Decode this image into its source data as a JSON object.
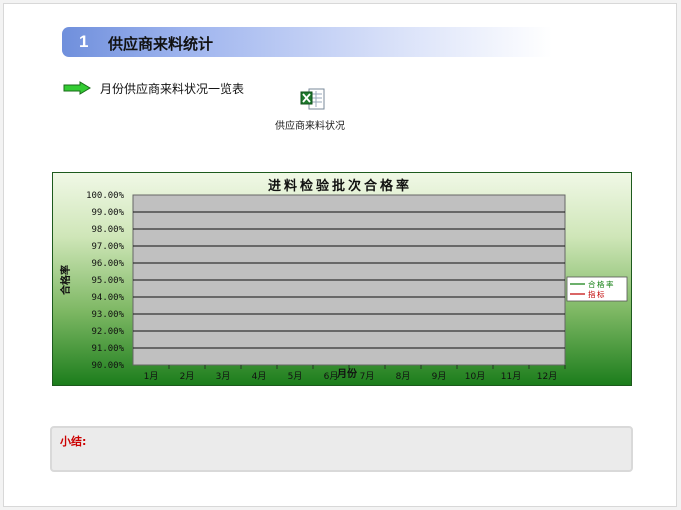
{
  "section": {
    "number": "1",
    "title": "供应商来料统计"
  },
  "subheading": "月份供应商来料状况一览表",
  "attachment": {
    "label": "供应商来料状况",
    "icon": "excel-file-icon"
  },
  "colors": {
    "target_line": "#c00000",
    "pass_line": "#0a7a0a",
    "header_start": "#6f8fdc"
  },
  "chart_data": {
    "type": "line",
    "title": "进料检验批次合格率",
    "xlabel": "月份",
    "ylabel": "合格率",
    "categories": [
      "1月",
      "2月",
      "3月",
      "4月",
      "5月",
      "6月",
      "7月",
      "8月",
      "9月",
      "10月",
      "11月",
      "12月"
    ],
    "ytick_labels": [
      "100.00%",
      "99.00%",
      "98.00%",
      "97.00%",
      "96.00%",
      "95.00%",
      "94.00%",
      "93.00%",
      "92.00%",
      "91.00%",
      "90.00%"
    ],
    "ylim": [
      0.9,
      1.0
    ],
    "grid": true,
    "legend_position": "right",
    "series": [
      {
        "name": "合格率",
        "values": []
      },
      {
        "name": "指标",
        "values": []
      }
    ]
  },
  "summary": {
    "label": "小结:"
  }
}
